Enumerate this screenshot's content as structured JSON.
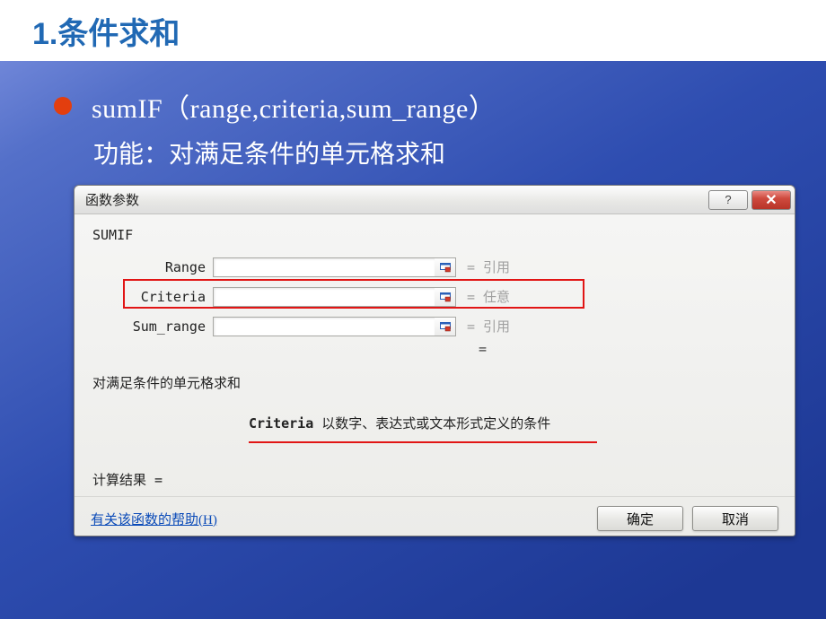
{
  "slide": {
    "heading": "1.条件求和",
    "code_line": "sumIF（range,criteria,sum_range）",
    "desc_line": "功能：对满足条件的单元格求和"
  },
  "dialog": {
    "title": "函数参数",
    "func_name": "SUMIF",
    "params": {
      "range": {
        "label": "Range",
        "value": "",
        "hint": "= 引用"
      },
      "criteria": {
        "label": "Criteria",
        "value": "",
        "hint": "= 任意"
      },
      "sum_range": {
        "label": "Sum_range",
        "value": "",
        "hint": "= 引用"
      }
    },
    "eq_lone": "=",
    "desc_main": "对满足条件的单元格求和",
    "desc_param_label": "Criteria",
    "desc_param_text": "以数字、表达式或文本形式定义的条件",
    "result_label": "计算结果 =",
    "help_link": "有关该函数的帮助(H)",
    "ok": "确定",
    "cancel": "取消",
    "help_btn": "?",
    "close_btn": "✕"
  }
}
